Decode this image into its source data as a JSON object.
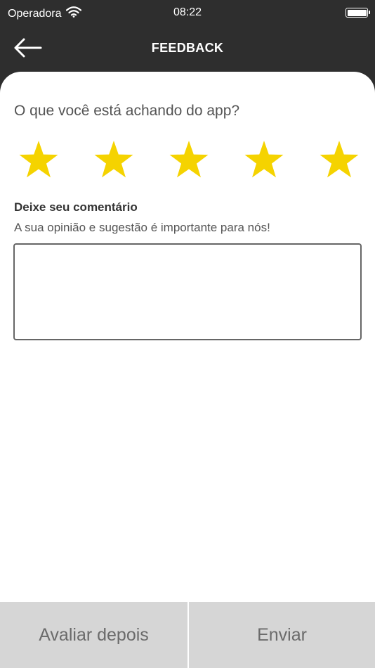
{
  "status_bar": {
    "carrier": "Operadora",
    "time": "08:22"
  },
  "header": {
    "title": "FEEDBACK"
  },
  "rating": {
    "question": "O que você está achando do app?",
    "stars_total": 5,
    "stars_selected": 5,
    "star_color": "#f5d300"
  },
  "comment": {
    "label": "Deixe seu comentário",
    "hint": "A sua opinião e sugestão é importante para nós!",
    "value": ""
  },
  "footer": {
    "later_label": "Avaliar depois",
    "send_label": "Enviar"
  },
  "colors": {
    "header_bg": "#2e2e2e",
    "button_bg": "#d6d6d6"
  }
}
